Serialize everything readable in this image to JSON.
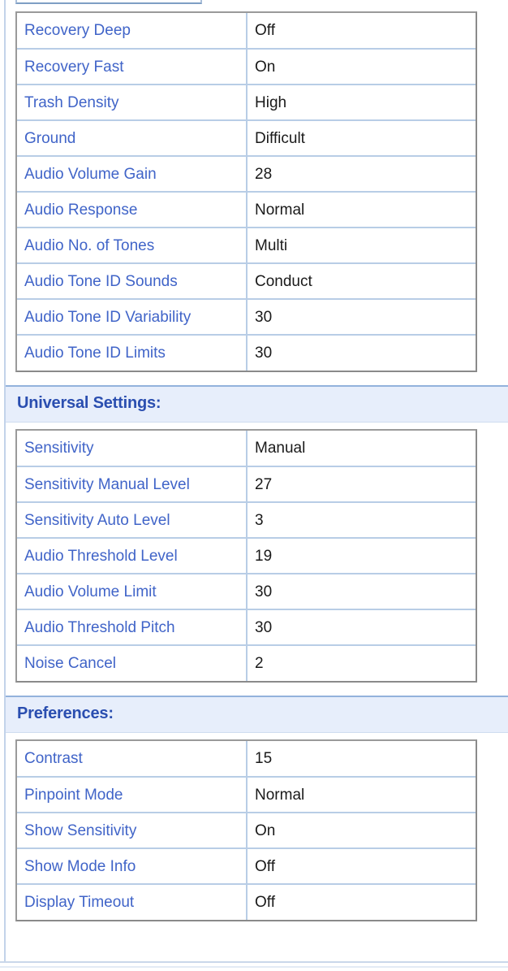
{
  "sections": [
    {
      "id": "mode-settings",
      "header": null,
      "rows": [
        {
          "label": "Recovery Deep",
          "value": "Off"
        },
        {
          "label": "Recovery Fast",
          "value": "On"
        },
        {
          "label": "Trash Density",
          "value": "High"
        },
        {
          "label": "Ground",
          "value": "Difficult"
        },
        {
          "label": "Audio Volume Gain",
          "value": "28"
        },
        {
          "label": "Audio Response",
          "value": "Normal"
        },
        {
          "label": "Audio No. of Tones",
          "value": "Multi"
        },
        {
          "label": "Audio Tone ID Sounds",
          "value": "Conduct"
        },
        {
          "label": "Audio Tone ID Variability",
          "value": "30"
        },
        {
          "label": "Audio Tone ID Limits",
          "value": "30"
        }
      ]
    },
    {
      "id": "universal-settings",
      "header": "Universal Settings:",
      "rows": [
        {
          "label": "Sensitivity",
          "value": "Manual"
        },
        {
          "label": "Sensitivity Manual Level",
          "value": "27"
        },
        {
          "label": "Sensitivity Auto Level",
          "value": "3"
        },
        {
          "label": "Audio Threshold Level",
          "value": "19"
        },
        {
          "label": "Audio Volume Limit",
          "value": "30"
        },
        {
          "label": "Audio Threshold Pitch",
          "value": "30"
        },
        {
          "label": "Noise Cancel",
          "value": "2"
        }
      ]
    },
    {
      "id": "preferences",
      "header": "Preferences:",
      "rows": [
        {
          "label": "Contrast",
          "value": "15"
        },
        {
          "label": "Pinpoint Mode",
          "value": "Normal"
        },
        {
          "label": "Show Sensitivity",
          "value": "On"
        },
        {
          "label": "Show Mode Info",
          "value": "Off"
        },
        {
          "label": "Display Timeout",
          "value": "Off"
        }
      ]
    }
  ],
  "colors": {
    "label_text": "#4064c8",
    "value_text": "#1a1a1a",
    "header_text": "#2a4eb0",
    "header_bg": "#e7eefb",
    "row_divider": "#b8cde6",
    "table_border": "#8a8a8a"
  }
}
